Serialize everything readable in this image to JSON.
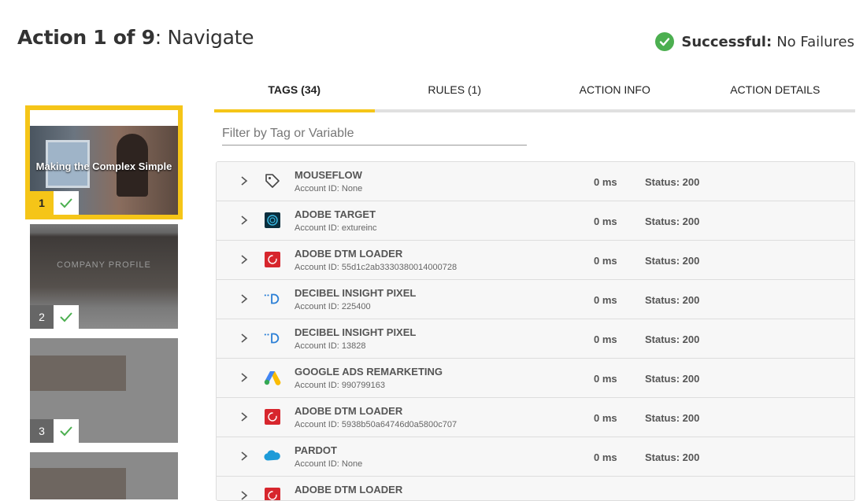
{
  "header": {
    "action_prefix": "Action 1 of 9",
    "action_name": ": Navigate",
    "status_label": "Successful:",
    "status_value": "No Failures"
  },
  "thumbnails": [
    {
      "number": "1",
      "caption": "Making the Complex Simple",
      "active": true
    },
    {
      "number": "2",
      "caption": "COMPANY PROFILE",
      "active": false
    },
    {
      "number": "3",
      "caption": "",
      "active": false
    }
  ],
  "tabs": [
    {
      "label": "TAGS (34)",
      "active": true
    },
    {
      "label": "RULES (1)",
      "active": false
    },
    {
      "label": "ACTION INFO",
      "active": false
    },
    {
      "label": "ACTION DETAILS",
      "active": false
    }
  ],
  "filter": {
    "placeholder": "Filter by Tag or Variable"
  },
  "tags": [
    {
      "name": "MOUSEFLOW",
      "account": "Account ID: None",
      "time": "0 ms",
      "status": "Status: 200",
      "icon": "tag-icon"
    },
    {
      "name": "ADOBE TARGET",
      "account": "Account ID: extureinc",
      "time": "0 ms",
      "status": "Status: 200",
      "icon": "adobe-target-icon"
    },
    {
      "name": "ADOBE DTM LOADER",
      "account": "Account ID: 55d1c2ab3330380014000728",
      "time": "0 ms",
      "status": "Status: 200",
      "icon": "adobe-dtm-icon"
    },
    {
      "name": "DECIBEL INSIGHT PIXEL",
      "account": "Account ID: 225400",
      "time": "0 ms",
      "status": "Status: 200",
      "icon": "decibel-icon"
    },
    {
      "name": "DECIBEL INSIGHT PIXEL",
      "account": "Account ID: 13828",
      "time": "0 ms",
      "status": "Status: 200",
      "icon": "decibel-icon"
    },
    {
      "name": "GOOGLE ADS REMARKETING",
      "account": "Account ID: 990799163",
      "time": "0 ms",
      "status": "Status: 200",
      "icon": "google-ads-icon"
    },
    {
      "name": "ADOBE DTM LOADER",
      "account": "Account ID: 5938b50a64746d0a5800c707",
      "time": "0 ms",
      "status": "Status: 200",
      "icon": "adobe-dtm-icon"
    },
    {
      "name": "PARDOT",
      "account": "Account ID: None",
      "time": "0 ms",
      "status": "Status: 200",
      "icon": "pardot-cloud-icon"
    },
    {
      "name": "ADOBE DTM LOADER",
      "account": "",
      "time": "",
      "status": "",
      "icon": "adobe-dtm-icon"
    }
  ],
  "colors": {
    "accent": "#f5c518",
    "success": "#4caf50"
  }
}
